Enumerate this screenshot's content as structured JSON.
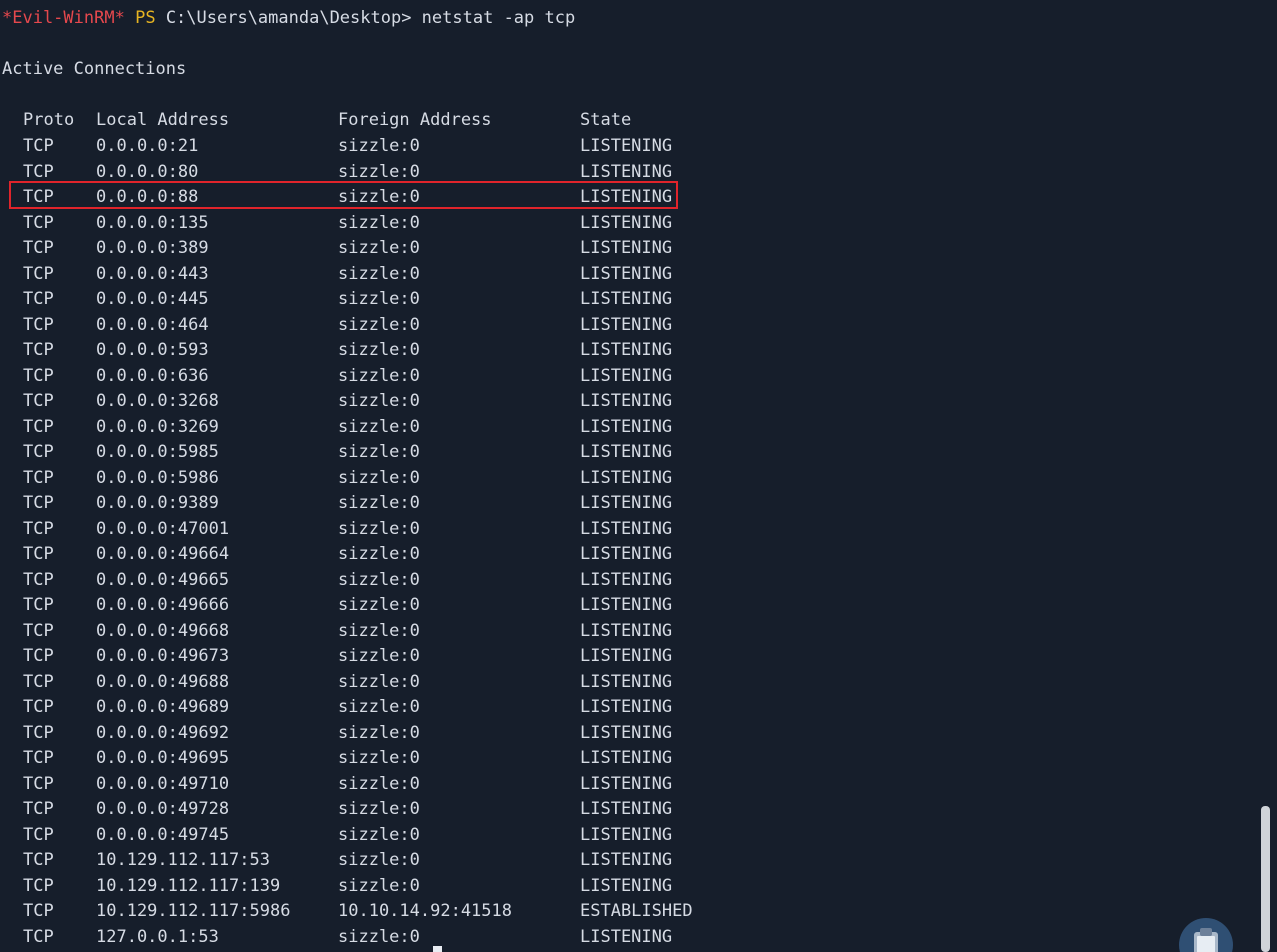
{
  "prompt": {
    "tool": "*Evil-WinRM*",
    "ps": "PS",
    "path_and_command": "C:\\Users\\amanda\\Desktop> netstat -ap tcp"
  },
  "heading": "Active Connections",
  "table": {
    "headers": [
      "Proto",
      "Local Address",
      "Foreign Address",
      "State"
    ],
    "rows": [
      [
        "TCP",
        "0.0.0.0:21",
        "sizzle:0",
        "LISTENING"
      ],
      [
        "TCP",
        "0.0.0.0:80",
        "sizzle:0",
        "LISTENING"
      ],
      [
        "TCP",
        "0.0.0.0:88",
        "sizzle:0",
        "LISTENING"
      ],
      [
        "TCP",
        "0.0.0.0:135",
        "sizzle:0",
        "LISTENING"
      ],
      [
        "TCP",
        "0.0.0.0:389",
        "sizzle:0",
        "LISTENING"
      ],
      [
        "TCP",
        "0.0.0.0:443",
        "sizzle:0",
        "LISTENING"
      ],
      [
        "TCP",
        "0.0.0.0:445",
        "sizzle:0",
        "LISTENING"
      ],
      [
        "TCP",
        "0.0.0.0:464",
        "sizzle:0",
        "LISTENING"
      ],
      [
        "TCP",
        "0.0.0.0:593",
        "sizzle:0",
        "LISTENING"
      ],
      [
        "TCP",
        "0.0.0.0:636",
        "sizzle:0",
        "LISTENING"
      ],
      [
        "TCP",
        "0.0.0.0:3268",
        "sizzle:0",
        "LISTENING"
      ],
      [
        "TCP",
        "0.0.0.0:3269",
        "sizzle:0",
        "LISTENING"
      ],
      [
        "TCP",
        "0.0.0.0:5985",
        "sizzle:0",
        "LISTENING"
      ],
      [
        "TCP",
        "0.0.0.0:5986",
        "sizzle:0",
        "LISTENING"
      ],
      [
        "TCP",
        "0.0.0.0:9389",
        "sizzle:0",
        "LISTENING"
      ],
      [
        "TCP",
        "0.0.0.0:47001",
        "sizzle:0",
        "LISTENING"
      ],
      [
        "TCP",
        "0.0.0.0:49664",
        "sizzle:0",
        "LISTENING"
      ],
      [
        "TCP",
        "0.0.0.0:49665",
        "sizzle:0",
        "LISTENING"
      ],
      [
        "TCP",
        "0.0.0.0:49666",
        "sizzle:0",
        "LISTENING"
      ],
      [
        "TCP",
        "0.0.0.0:49668",
        "sizzle:0",
        "LISTENING"
      ],
      [
        "TCP",
        "0.0.0.0:49673",
        "sizzle:0",
        "LISTENING"
      ],
      [
        "TCP",
        "0.0.0.0:49688",
        "sizzle:0",
        "LISTENING"
      ],
      [
        "TCP",
        "0.0.0.0:49689",
        "sizzle:0",
        "LISTENING"
      ],
      [
        "TCP",
        "0.0.0.0:49692",
        "sizzle:0",
        "LISTENING"
      ],
      [
        "TCP",
        "0.0.0.0:49695",
        "sizzle:0",
        "LISTENING"
      ],
      [
        "TCP",
        "0.0.0.0:49710",
        "sizzle:0",
        "LISTENING"
      ],
      [
        "TCP",
        "0.0.0.0:49728",
        "sizzle:0",
        "LISTENING"
      ],
      [
        "TCP",
        "0.0.0.0:49745",
        "sizzle:0",
        "LISTENING"
      ],
      [
        "TCP",
        "10.129.112.117:53",
        "sizzle:0",
        "LISTENING"
      ],
      [
        "TCP",
        "10.129.112.117:139",
        "sizzle:0",
        "LISTENING"
      ],
      [
        "TCP",
        "10.129.112.117:5986",
        "10.10.14.92:41518",
        "ESTABLISHED"
      ],
      [
        "TCP",
        "127.0.0.1:53",
        "sizzle:0",
        "LISTENING"
      ]
    ],
    "highlighted_row_index": 2
  },
  "colors": {
    "background": "#161e2b",
    "text": "#d6dbe4",
    "evil_winrm": "#e5484d",
    "ps": "#e6b422",
    "highlight_border": "#e0242b",
    "clipboard_button": "#2f4f73"
  },
  "icons": {
    "clipboard_button": "clipboard-icon"
  }
}
